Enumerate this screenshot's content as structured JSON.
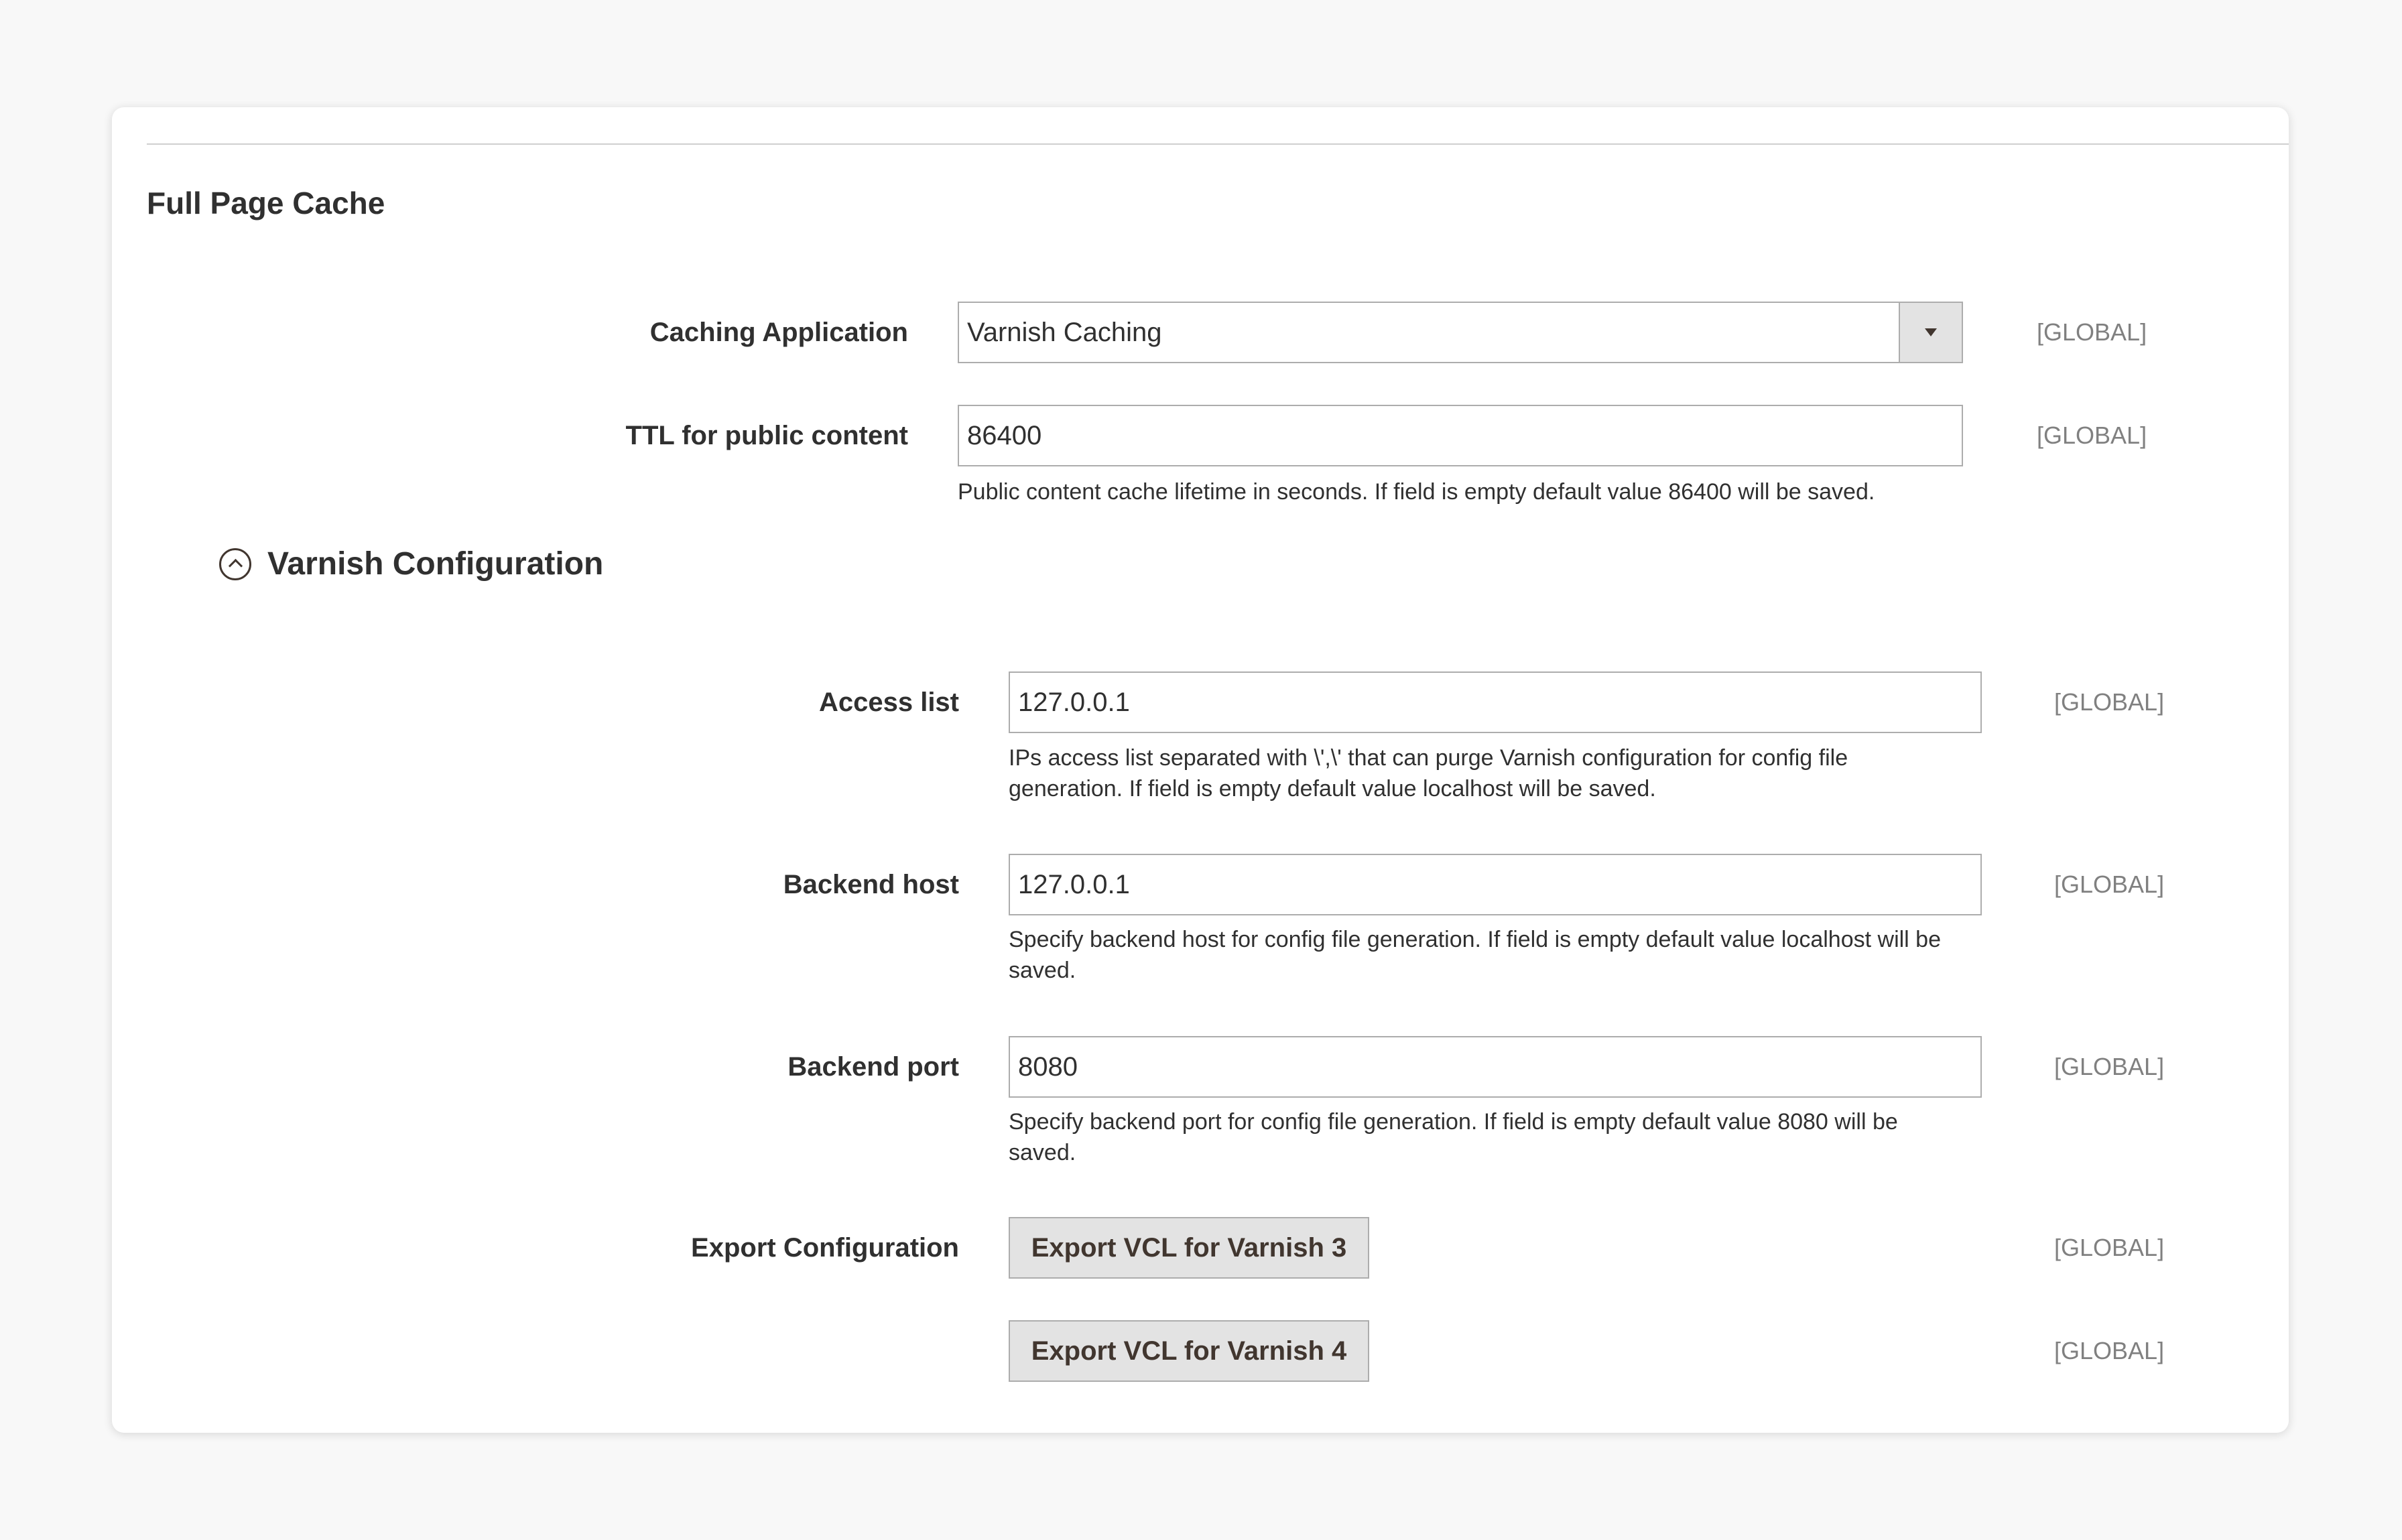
{
  "section": {
    "title": "Full Page Cache"
  },
  "caching_application": {
    "label": "Caching Application",
    "value": "Varnish Caching",
    "scope": "[GLOBAL]"
  },
  "ttl": {
    "label": "TTL for public content",
    "value": "86400",
    "note": "Public content cache lifetime in seconds. If field is empty default value 86400 will be saved.",
    "scope": "[GLOBAL]"
  },
  "varnish": {
    "title": "Varnish Configuration",
    "access_list": {
      "label": "Access list",
      "value": "127.0.0.1",
      "note_line1": "IPs access list separated with \\',\\' that can purge Varnish configuration for config file",
      "note_line2": "generation. If field is empty default value localhost will be saved.",
      "scope": "[GLOBAL]"
    },
    "backend_host": {
      "label": "Backend host",
      "value": "127.0.0.1",
      "note_line1": "Specify backend host for config file generation. If field is empty default value localhost will be",
      "note_line2": "saved.",
      "scope": "[GLOBAL]"
    },
    "backend_port": {
      "label": "Backend port",
      "value": "8080",
      "note_line1": "Specify backend port for config file generation. If field is empty default value 8080 will be",
      "note_line2": "saved.",
      "scope": "[GLOBAL]"
    },
    "export": {
      "label": "Export Configuration",
      "button3": "Export VCL for Varnish 3",
      "button4": "Export VCL for Varnish 4",
      "scope3": "[GLOBAL]",
      "scope4": "[GLOBAL]"
    }
  }
}
